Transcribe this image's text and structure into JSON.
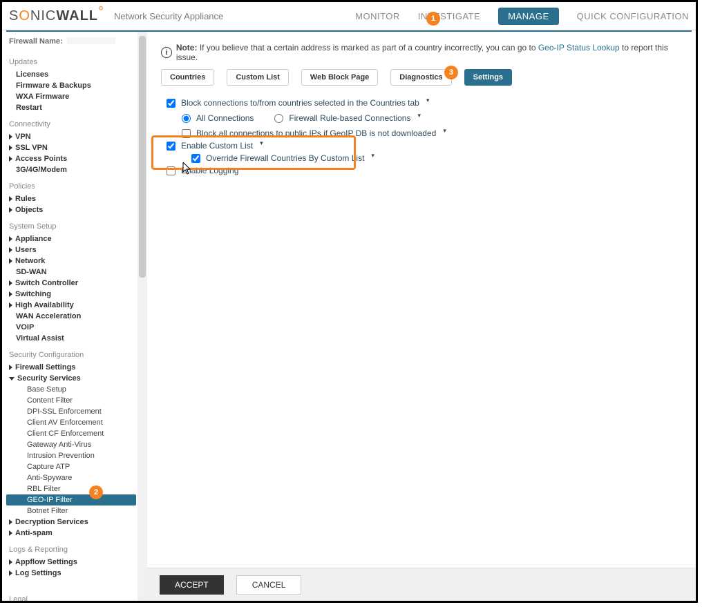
{
  "brand": {
    "part1": "S",
    "o": "O",
    "part2": "NIC",
    "wall": "WALL"
  },
  "subtitle": "Network Security Appliance",
  "nav": {
    "monitor": "MONITOR",
    "investigate": "INVESTIGATE",
    "manage": "MANAGE",
    "quick": "QUICK CONFIGURATION"
  },
  "firewall_name_label": "Firewall Name:",
  "sidebar": {
    "updates": {
      "title": "Updates",
      "items": [
        "Licenses",
        "Firmware & Backups",
        "WXA Firmware",
        "Restart"
      ]
    },
    "connectivity": {
      "title": "Connectivity",
      "items": [
        "VPN",
        "SSL VPN",
        "Access Points",
        "3G/4G/Modem"
      ]
    },
    "policies": {
      "title": "Policies",
      "items": [
        "Rules",
        "Objects"
      ]
    },
    "system": {
      "title": "System Setup",
      "items": [
        "Appliance",
        "Users",
        "Network",
        "SD-WAN",
        "Switch Controller",
        "Switching",
        "High Availability",
        "WAN Acceleration",
        "VOIP",
        "Virtual Assist"
      ]
    },
    "security": {
      "title": "Security Configuration",
      "firewall": "Firewall Settings",
      "services": "Security Services",
      "subs": [
        "Base Setup",
        "Content Filter",
        "DPI-SSL Enforcement",
        "Client AV Enforcement",
        "Client CF Enforcement",
        "Gateway Anti-Virus",
        "Intrusion Prevention",
        "Capture ATP",
        "Anti-Spyware",
        "RBL Filter",
        "GEO-IP Filter",
        "Botnet Filter"
      ],
      "decryption": "Decryption Services",
      "antispam": "Anti-spam"
    },
    "logs": {
      "title": "Logs & Reporting",
      "items": [
        "Appflow Settings",
        "Log Settings"
      ]
    },
    "legal": "Legal"
  },
  "note": {
    "label": "Note:",
    "text": " If you believe that a certain address is marked as part of a country incorrectly, you can go to ",
    "link": "Geo-IP Status Lookup",
    "tail": " to report this issue."
  },
  "subtabs": {
    "countries": "Countries",
    "custom": "Custom List",
    "web": "Web Block Page",
    "diag": "Diagnostics",
    "settings": "Settings"
  },
  "opts": {
    "block": "Block connections to/from countries selected in the Countries tab",
    "all": "All Connections",
    "rule": "Firewall Rule-based Connections",
    "blockall": "Block all connections to public IPs if GeoIP DB is not downloaded",
    "enable": "Enable Custom List",
    "override": "Override Firewall Countries By Custom List",
    "logging": "Enable Logging"
  },
  "footer": {
    "accept": "ACCEPT",
    "cancel": "CANCEL"
  },
  "badges": {
    "one": "1",
    "two": "2",
    "three": "3"
  }
}
